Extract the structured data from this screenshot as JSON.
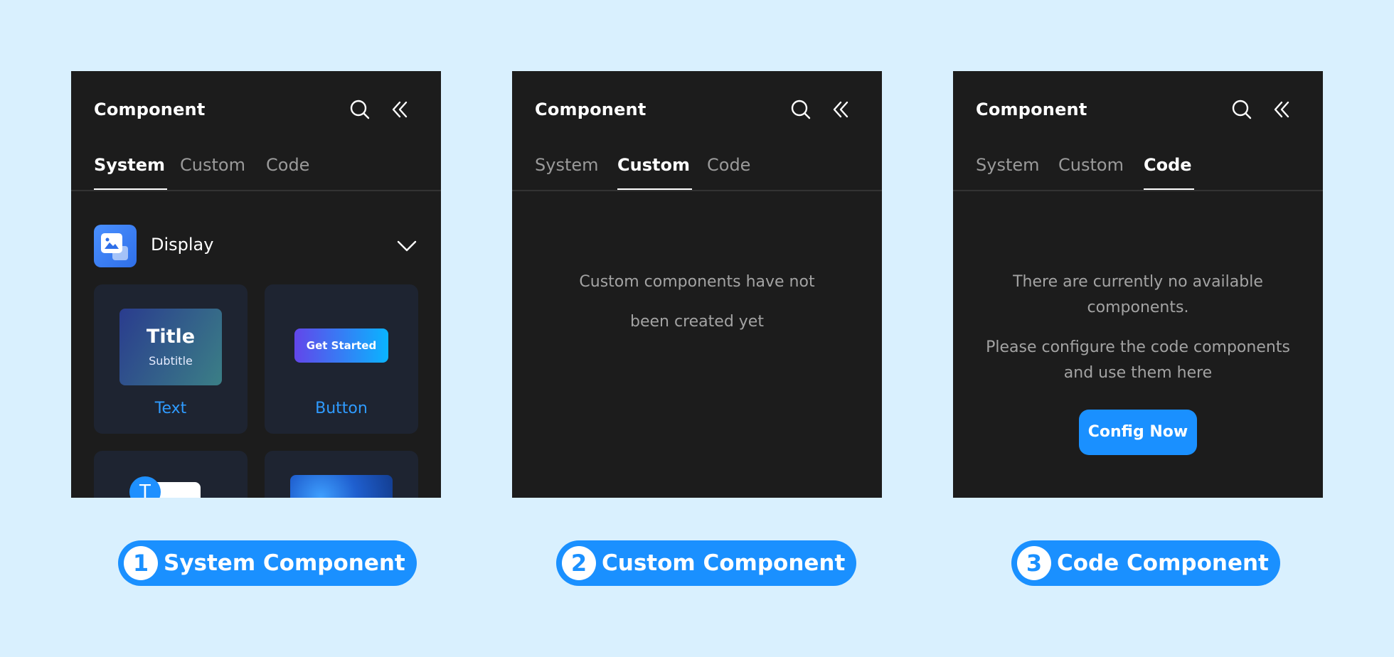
{
  "panels": [
    {
      "title": "Component",
      "tabs": [
        "System",
        "Custom",
        "Code"
      ],
      "active_tab": "System",
      "section": {
        "label": "Display",
        "icon": "image-gallery-icon"
      },
      "cards": [
        {
          "label": "Text",
          "preview_title": "Title",
          "preview_subtitle": "Subtitle"
        },
        {
          "label": "Button",
          "preview_button": "Get Started"
        },
        {
          "label": "",
          "preview_avatar": "T"
        },
        {
          "label": ""
        }
      ]
    },
    {
      "title": "Component",
      "tabs": [
        "System",
        "Custom",
        "Code"
      ],
      "active_tab": "Custom",
      "empty_message": [
        "Custom components have not",
        "been created yet"
      ]
    },
    {
      "title": "Component",
      "tabs": [
        "System",
        "Custom",
        "Code"
      ],
      "active_tab": "Code",
      "empty_message": [
        "There are currently no available",
        "components."
      ],
      "hint_message": [
        "Please configure the code components",
        "and use them here"
      ],
      "action_label": "Config Now"
    }
  ],
  "captions": [
    {
      "number": "1",
      "label": "System Component"
    },
    {
      "number": "2",
      "label": "Custom Component"
    },
    {
      "number": "3",
      "label": "Code Component"
    }
  ],
  "colors": {
    "background": "#d9f0fe",
    "panel": "#1c1c1c",
    "accent": "#1a90ff",
    "card": "#1e2431"
  },
  "icons": [
    "search-icon",
    "double-chevron-left-icon",
    "chevron-down-icon"
  ]
}
